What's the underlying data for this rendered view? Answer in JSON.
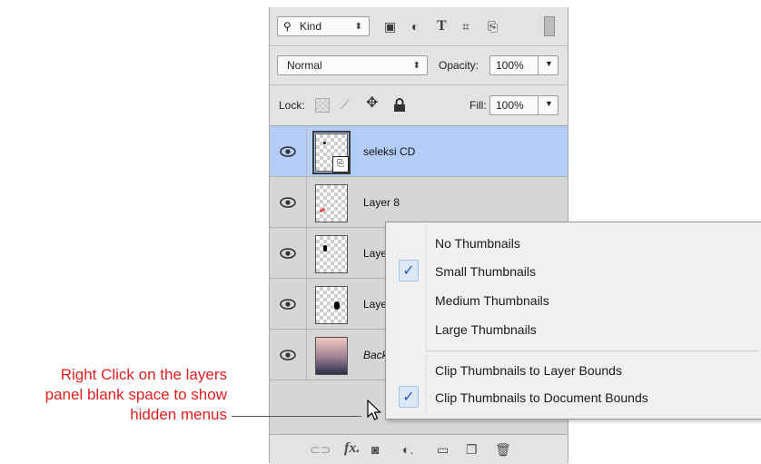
{
  "filter": {
    "kind_label": "Kind",
    "icons": [
      "image-filter-icon",
      "adjustment-filter-icon",
      "type-filter-icon",
      "shape-filter-icon",
      "smart-object-filter-icon",
      "filter-toggle-icon"
    ]
  },
  "blend": {
    "mode": "Normal",
    "opacity_label": "Opacity:",
    "opacity_value": "100%"
  },
  "lock": {
    "label": "Lock:",
    "fill_label": "Fill:",
    "fill_value": "100%"
  },
  "layers": [
    {
      "name": "seleksi CD",
      "selected": true
    },
    {
      "name": "Layer 8"
    },
    {
      "name": "Laye"
    },
    {
      "name": "Laye"
    },
    {
      "name": "Back",
      "italic": true
    }
  ],
  "context_menu": {
    "items": [
      {
        "label": "No Thumbnails",
        "checked": false
      },
      {
        "label": "Small Thumbnails",
        "checked": true
      },
      {
        "label": "Medium Thumbnails",
        "checked": false
      },
      {
        "label": "Large Thumbnails",
        "checked": false
      },
      {
        "label": "Clip Thumbnails to Layer Bounds",
        "checked": false
      },
      {
        "label": "Clip Thumbnails to Document Bounds",
        "checked": true
      }
    ],
    "check_glyph": "✓"
  },
  "annotation": {
    "line1": "Right Click on the layers",
    "line2": "panel blank space to show",
    "line3": "hidden menus",
    "color": "#e11f1f"
  },
  "colors": {
    "selected_layer": "#b3cdf7",
    "panel_bg": "#d6d6d6"
  }
}
